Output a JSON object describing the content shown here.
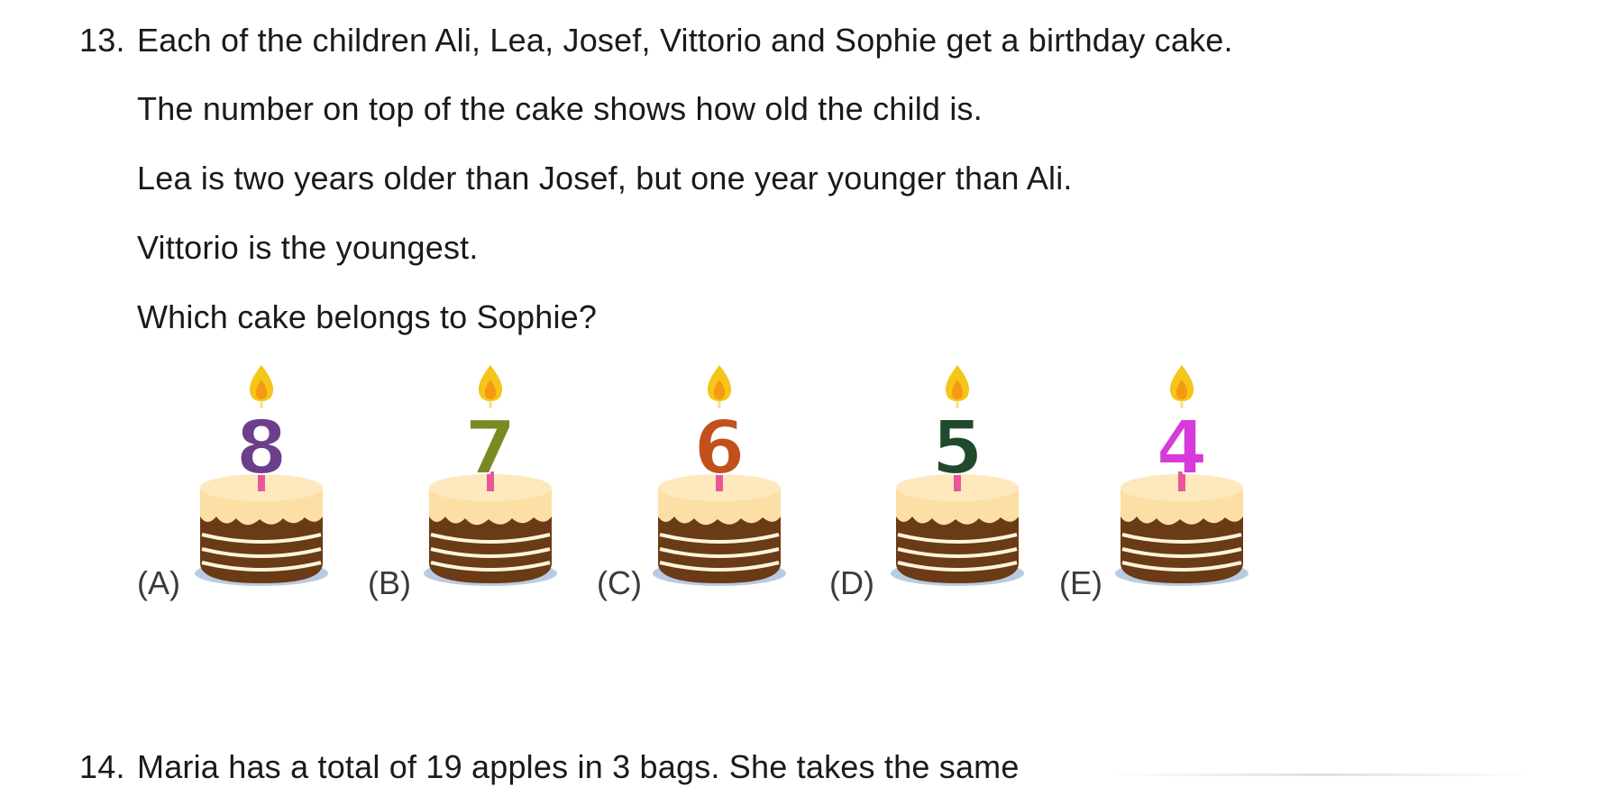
{
  "question13": {
    "number": "13.",
    "lines": [
      "Each of the children Ali, Lea, Josef, Vittorio and Sophie get a birthday cake.",
      "The number on top of the cake shows how old the child is.",
      "Lea is two years older than Josef, but one year younger than Ali.",
      "Vittorio is the youngest.",
      "Which cake belongs to Sophie?"
    ],
    "options": [
      {
        "label": "(A)",
        "candle_number": "8",
        "candle_color": "#6b3f8c"
      },
      {
        "label": "(B)",
        "candle_number": "7",
        "candle_color": "#7a8a22"
      },
      {
        "label": "(C)",
        "candle_number": "6",
        "candle_color": "#c2501d"
      },
      {
        "label": "(D)",
        "candle_number": "5",
        "candle_color": "#1f4a2c"
      },
      {
        "label": "(E)",
        "candle_number": "4",
        "candle_color": "#d63adb"
      }
    ]
  },
  "question14": {
    "number": "14.",
    "text": "Maria has a total of 19 apples in 3 bags. She takes the same"
  },
  "colors": {
    "flame": "#f5c518",
    "flame_inner": "#f39a12",
    "wick": "#f5e08a",
    "candle_stick": "#e9579a",
    "frosting": "#fbdfa4",
    "frosting_top": "#fde9bd",
    "cake_brown": "#6b3a16",
    "cream_stripe": "#fff4dd",
    "plate": "#b9cbe2"
  }
}
